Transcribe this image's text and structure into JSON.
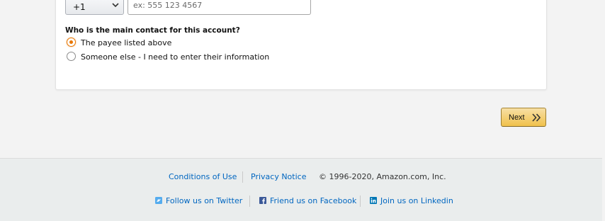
{
  "phone": {
    "country_code": "+1",
    "placeholder": "ex: 555 123 4567",
    "value": ""
  },
  "contact_question": {
    "label": "Who is the main contact for this account?",
    "options": [
      {
        "label": "The payee listed above",
        "selected": true
      },
      {
        "label": "Someone else - I need to enter their information",
        "selected": false
      }
    ]
  },
  "actions": {
    "next_label": "Next"
  },
  "footer": {
    "links": [
      "Conditions of Use",
      "Privacy Notice"
    ],
    "copyright": "© 1996-2020, Amazon.com, Inc.",
    "social": [
      {
        "label": "Follow us on Twitter",
        "icon": "twitter-icon"
      },
      {
        "label": "Friend us on Facebook",
        "icon": "facebook-icon"
      },
      {
        "label": "Join us on Linkedin",
        "icon": "linkedin-icon"
      }
    ]
  },
  "colors": {
    "accent_orange": "#e77600",
    "link_blue": "#0066c0",
    "button_yellow": "#f0c14b"
  }
}
